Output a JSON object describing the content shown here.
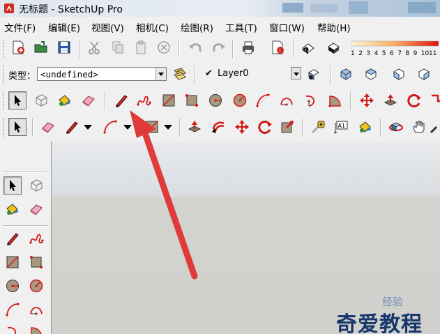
{
  "window": {
    "title": "无标题 - SketchUp Pro"
  },
  "menu": [
    "文件(F)",
    "编辑(E)",
    "视图(V)",
    "相机(C)",
    "绘图(R)",
    "工具(T)",
    "窗口(W)",
    "帮助(H)"
  ],
  "entity_info": {
    "type_label": "类型：",
    "type_value": "<undefined>"
  },
  "layers": {
    "check": "✔",
    "current_layer": "Layer0"
  },
  "shadow_scale": {
    "numbers": [
      "1",
      "2",
      "3",
      "4",
      "5",
      "6",
      "7",
      "8",
      "9",
      "10",
      "11"
    ]
  },
  "watermark": {
    "text": "奇爱教程",
    "subtext": "经验"
  },
  "colors": {
    "accent_red": "#d21818",
    "arrow": "#e03030",
    "title_blue": "#a9c2da"
  }
}
